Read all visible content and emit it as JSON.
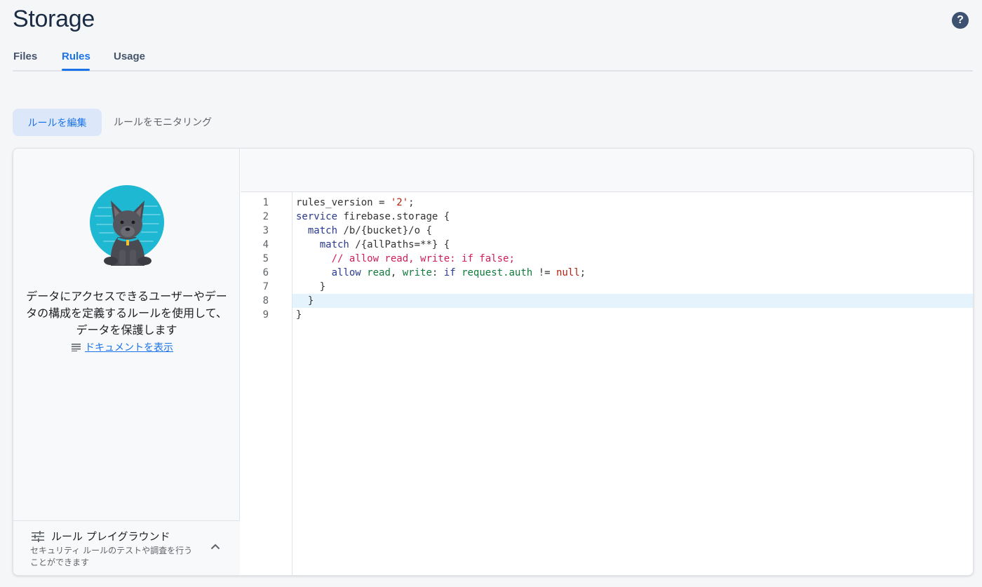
{
  "header": {
    "title": "Storage",
    "help_label": "?"
  },
  "tabs": [
    {
      "label": "Files",
      "active": false
    },
    {
      "label": "Rules",
      "active": true
    },
    {
      "label": "Usage",
      "active": false
    }
  ],
  "segments": {
    "edit_label": "ルールを編集",
    "monitor_label": "ルールをモニタリング"
  },
  "sidebar": {
    "description": "データにアクセスできるユーザーやデータの構成を定義するルールを使用して、データを保護します",
    "doc_link_label": "ドキュメントを表示",
    "playground": {
      "title": "ルール プレイグラウンド",
      "subtitle": "セキュリティ ルールのテストや調査を行うことができます"
    }
  },
  "editor": {
    "line_numbers": [
      "1",
      "2",
      "3",
      "4",
      "5",
      "6",
      "7",
      "8",
      "9"
    ],
    "highlighted_line": 8,
    "lines": [
      {
        "indent": "",
        "tokens": [
          {
            "t": "rules_version = ",
            "c": ""
          },
          {
            "t": "'2'",
            "c": "s"
          },
          {
            "t": ";",
            "c": ""
          }
        ]
      },
      {
        "indent": "",
        "tokens": [
          {
            "t": "service",
            "c": "k"
          },
          {
            "t": " firebase.storage {",
            "c": ""
          }
        ]
      },
      {
        "indent": "  ",
        "tokens": [
          {
            "t": "match",
            "c": "k"
          },
          {
            "t": " /b/{bucket}/o {",
            "c": ""
          }
        ]
      },
      {
        "indent": "    ",
        "tokens": [
          {
            "t": "match",
            "c": "k"
          },
          {
            "t": " /{allPaths=**} {",
            "c": ""
          }
        ]
      },
      {
        "indent": "      ",
        "tokens": [
          {
            "t": "// allow read, write: if false;",
            "c": "c"
          }
        ]
      },
      {
        "indent": "      ",
        "tokens": [
          {
            "t": "allow",
            "c": "k"
          },
          {
            "t": " ",
            "c": ""
          },
          {
            "t": "read",
            "c": "f"
          },
          {
            "t": ", ",
            "c": ""
          },
          {
            "t": "write",
            "c": "f"
          },
          {
            "t": ": ",
            "c": ""
          },
          {
            "t": "if",
            "c": "k"
          },
          {
            "t": " ",
            "c": ""
          },
          {
            "t": "request.auth",
            "c": "f"
          },
          {
            "t": " != ",
            "c": ""
          },
          {
            "t": "null",
            "c": "n"
          },
          {
            "t": ";",
            "c": ""
          }
        ]
      },
      {
        "indent": "    ",
        "tokens": [
          {
            "t": "}",
            "c": ""
          }
        ]
      },
      {
        "indent": "  ",
        "tokens": [
          {
            "t": "}",
            "c": ""
          }
        ]
      },
      {
        "indent": "",
        "tokens": [
          {
            "t": "}",
            "c": ""
          }
        ]
      }
    ]
  },
  "colors": {
    "accent": "#1a73e8",
    "title": "#1a2b44"
  }
}
